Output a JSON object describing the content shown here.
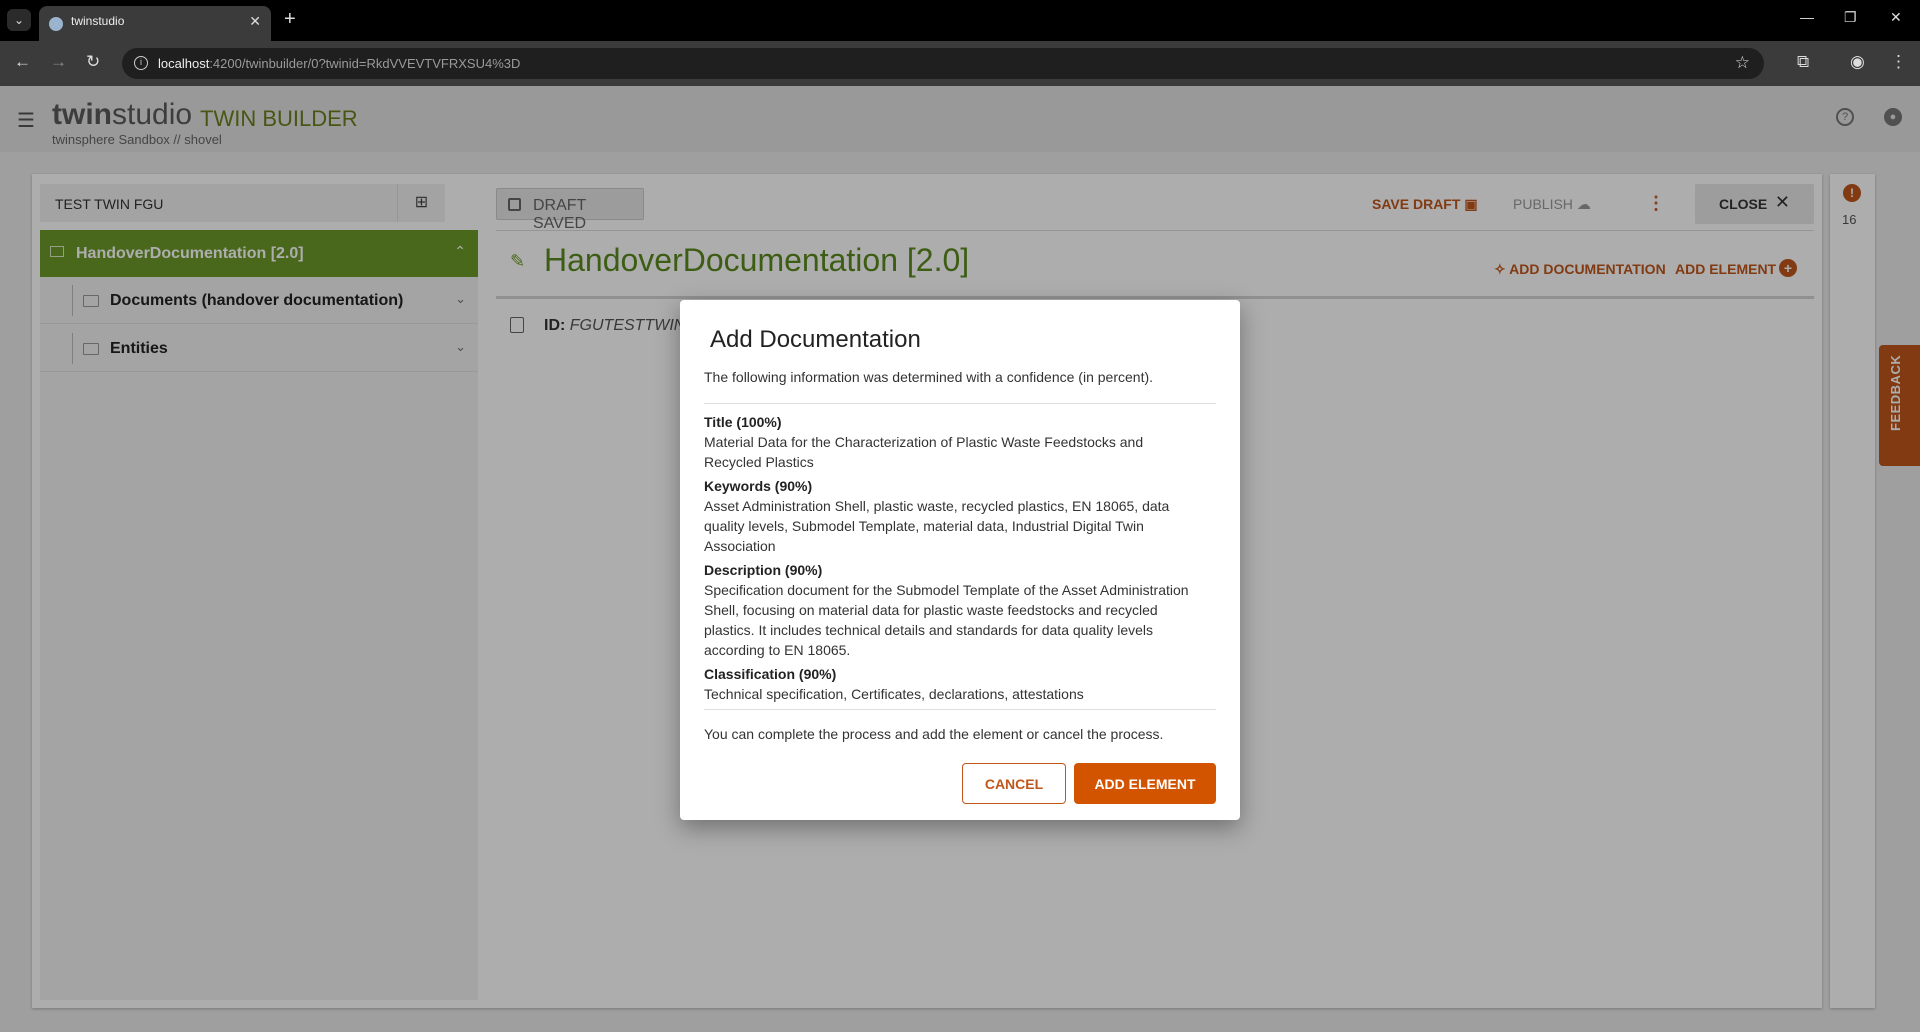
{
  "browser": {
    "tab_title": "twinstudio",
    "url_host": "localhost",
    "url_path": ":4200/twinbuilder/0?twinid=RkdVVEVTVFRXSU4%3D"
  },
  "app": {
    "brand_bold": "twin",
    "brand_light": "studio",
    "module": "TWIN BUILDER",
    "subtitle": "twinsphere Sandbox // shovel"
  },
  "twin": {
    "name": "TEST TWIN FGU"
  },
  "tree": {
    "root_label": "HandoverDocumentation [2.0]",
    "items": [
      {
        "label": "Documents (handover documentation)"
      },
      {
        "label": "Entities"
      }
    ]
  },
  "toolbar": {
    "draft_status": "DRAFT SAVED",
    "save_draft": "SAVE DRAFT",
    "publish": "PUBLISH",
    "close": "CLOSE"
  },
  "element": {
    "title": "HandoverDocumentation [2.0]",
    "add_documentation": "ADD DOCUMENTATION",
    "add_element": "ADD ELEMENT",
    "id_label": "ID:",
    "id_value": "FGUTESTTWIN/"
  },
  "notifications": {
    "count": "16"
  },
  "feedback_label": "FEEDBACK",
  "dialog": {
    "title": "Add Documentation",
    "intro": "The following information was determined with a confidence (in percent).",
    "sections": [
      {
        "head": "Title (100%)",
        "body": "Material Data for the Characterization of Plastic Waste Feedstocks and Recycled Plastics"
      },
      {
        "head": "Keywords (90%)",
        "body": "Asset Administration Shell, plastic waste, recycled plastics, EN 18065, data quality levels, Submodel Template, material data, Industrial Digital Twin Association"
      },
      {
        "head": "Description (90%)",
        "body": "Specification document for the Submodel Template of the Asset Administration Shell, focusing on material data for plastic waste feedstocks and recycled plastics. It includes technical details and standards for data quality levels according to EN 18065."
      },
      {
        "head": "Classification (90%)",
        "body": "Technical specification, Certificates, declarations, attestations"
      }
    ],
    "note": "You can complete the process and add the element or cancel the process.",
    "cancel": "CANCEL",
    "confirm": "ADD ELEMENT"
  },
  "colors": {
    "accent": "#c0561b",
    "primary_green": "#6e9a2a",
    "confirm_button": "#d35400"
  }
}
